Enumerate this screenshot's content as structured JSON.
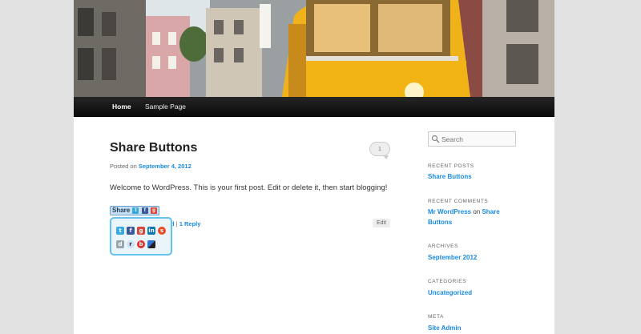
{
  "nav": {
    "home": "Home",
    "sample_page": "Sample Page"
  },
  "post": {
    "title": "Share Buttons",
    "comment_count": "1",
    "posted_on": "Posted on",
    "date": "September 4, 2012",
    "body": "Welcome to WordPress. This is your first post. Edit or delete it, then start blogging!",
    "share_label": "Share",
    "footer_fragment": "d",
    "footer_separator": "|",
    "reply_link": "1 Reply",
    "edit_label": "Edit"
  },
  "sidebar": {
    "search_placeholder": "Search",
    "recent_posts_title": "RECENT POSTS",
    "recent_post": "Share Buttons",
    "recent_comments_title": "RECENT COMMENTS",
    "comment_author": "Mr WordPress",
    "comment_on": "on",
    "comment_post_line1": "Share",
    "comment_post_line2": "Buttons",
    "archives_title": "ARCHIVES",
    "archive_month": "September 2012",
    "categories_title": "CATEGORIES",
    "category": "Uncategorized",
    "meta_title": "META",
    "site_admin": "Site Admin"
  },
  "share_icons": [
    "twitter-icon",
    "facebook-icon",
    "google-plus-icon",
    "linkedin-icon",
    "stumbleupon-icon",
    "digg-icon",
    "reddit-icon",
    "buzz-icon",
    "delicious-icon"
  ],
  "colors": {
    "link": "#1b8be0",
    "nav_bg": "#111111",
    "popup_border": "#66c2ee",
    "tram_yellow": "#f0b21a"
  }
}
